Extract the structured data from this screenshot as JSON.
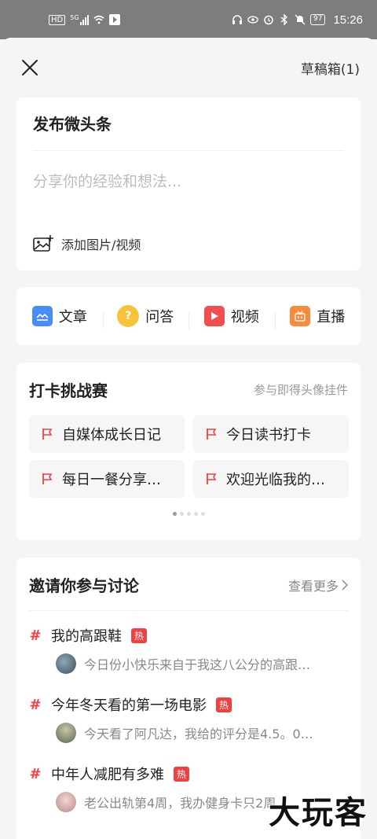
{
  "status_bar": {
    "network": "HD",
    "signal": "5G",
    "battery": "97",
    "time": "15:26"
  },
  "header": {
    "drafts_label": "草稿箱(1)"
  },
  "post": {
    "title": "发布微头条",
    "placeholder": "分享你的经验和想法...",
    "add_media_label": "添加图片/视频"
  },
  "post_types": [
    {
      "label": "文章",
      "icon": "article-icon",
      "color": "#4a8cf7"
    },
    {
      "label": "问答",
      "icon": "qa-icon",
      "color": "#f8c33a"
    },
    {
      "label": "视频",
      "icon": "video-icon",
      "color": "#f24e4e"
    },
    {
      "label": "直播",
      "icon": "live-icon",
      "color": "#fb8a3b"
    }
  ],
  "challenge": {
    "title": "打卡挑战赛",
    "subtitle": "参与即得头像挂件",
    "items": [
      {
        "label": "自媒体成长日记"
      },
      {
        "label": "今日读书打卡"
      },
      {
        "label": "每日一餐分享…"
      },
      {
        "label": "欢迎光临我的…"
      }
    ],
    "pages": 5,
    "active_page": 0
  },
  "discussion": {
    "title": "邀请你参与讨论",
    "more_label": "查看更多",
    "topics": [
      {
        "title": "我的高跟鞋",
        "badge": "热",
        "desc": "今日份小快乐来自于我这八公分的高跟…"
      },
      {
        "title": "今年冬天看的第一场电影",
        "badge": "热",
        "desc": "今天看了阿凡达，我给的评分是4.5。0…"
      },
      {
        "title": "中年人减肥有多难",
        "badge": "热",
        "desc": "老公出轨第4周，我办健身卡只2周"
      }
    ]
  },
  "watermark": "大玩客",
  "colors": {
    "accent_red": "#f04142",
    "status_bar": "#7d7d7d"
  }
}
